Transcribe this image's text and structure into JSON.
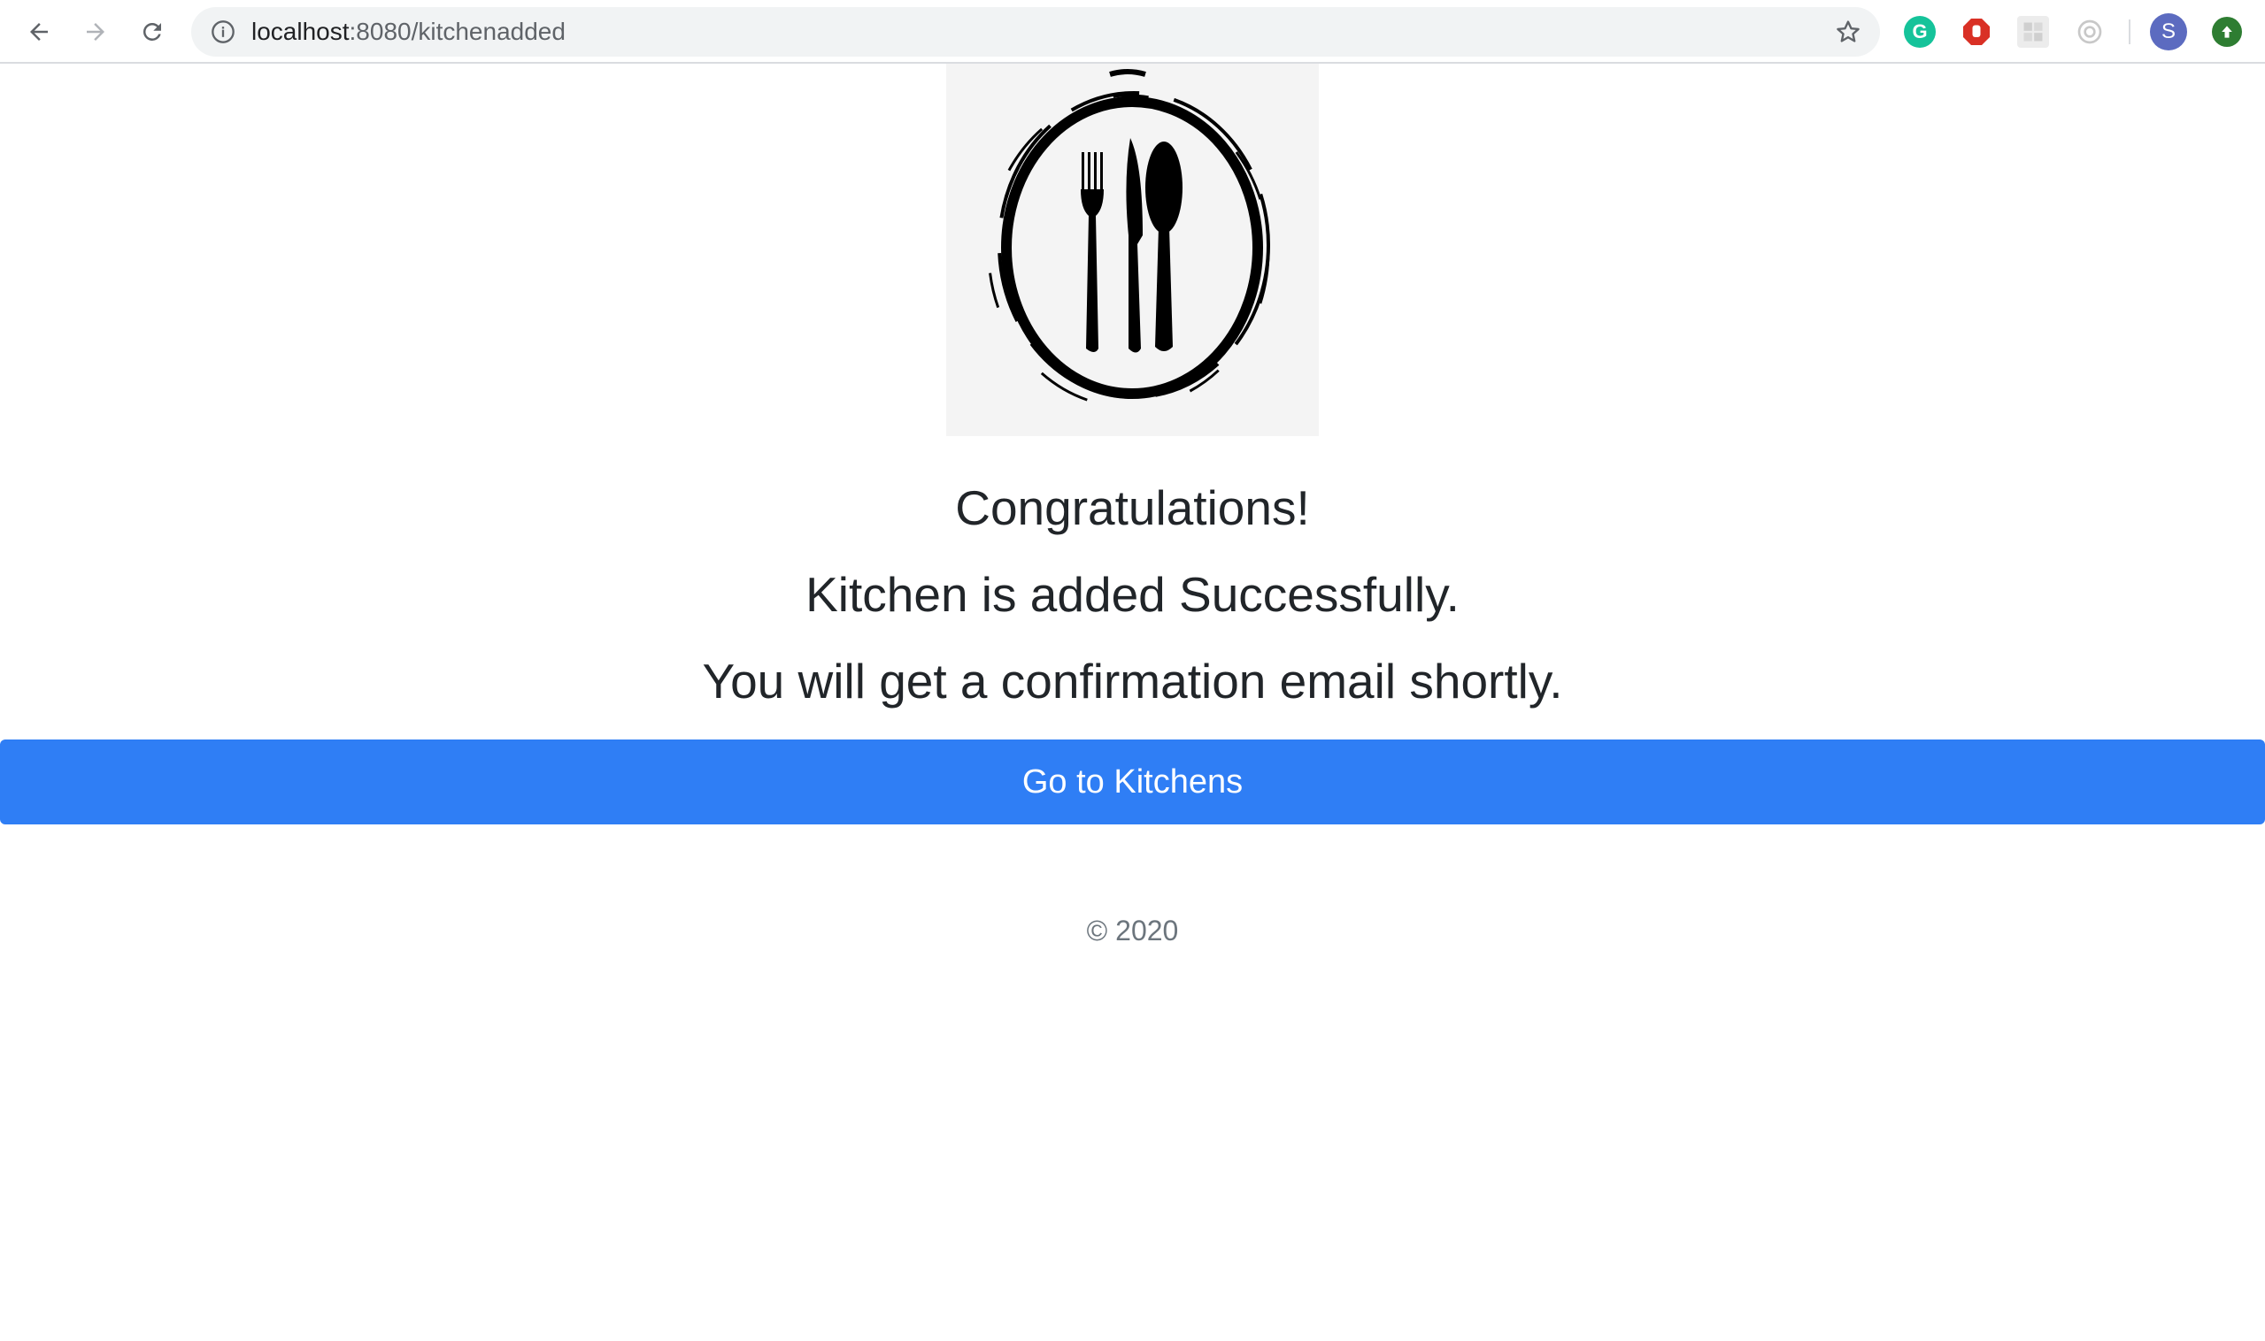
{
  "browser": {
    "url_host": "localhost",
    "url_path": ":8080/kitchenadded",
    "profile_initial": "S",
    "extensions": {
      "grammarly_letter": "G"
    }
  },
  "page": {
    "headline": "Congratulations!",
    "line_2": "Kitchen is added Successfully.",
    "line_3": "You will get a confirmation email shortly.",
    "button_label": "Go to Kitchens",
    "footer": "© 2020"
  },
  "colors": {
    "primary_button": "#2f7ef5",
    "text": "#212529",
    "footer_text": "#6c757d"
  }
}
